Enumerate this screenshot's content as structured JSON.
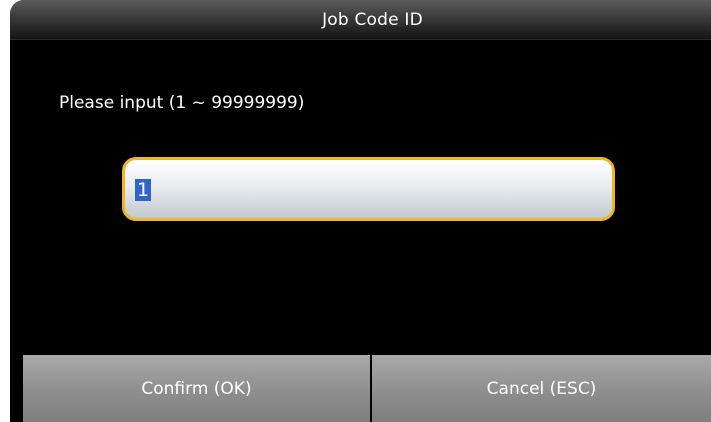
{
  "window": {
    "title": "Job Code ID"
  },
  "form": {
    "prompt": "Please input (1 ~ 99999999)",
    "input_value": "1"
  },
  "buttons": {
    "confirm_label": "Confirm (OK)",
    "cancel_label": "Cancel (ESC)"
  },
  "colors": {
    "background": "#000000",
    "input_border": "#f0b428",
    "selection": "#2f66c4",
    "button": "#969696"
  }
}
